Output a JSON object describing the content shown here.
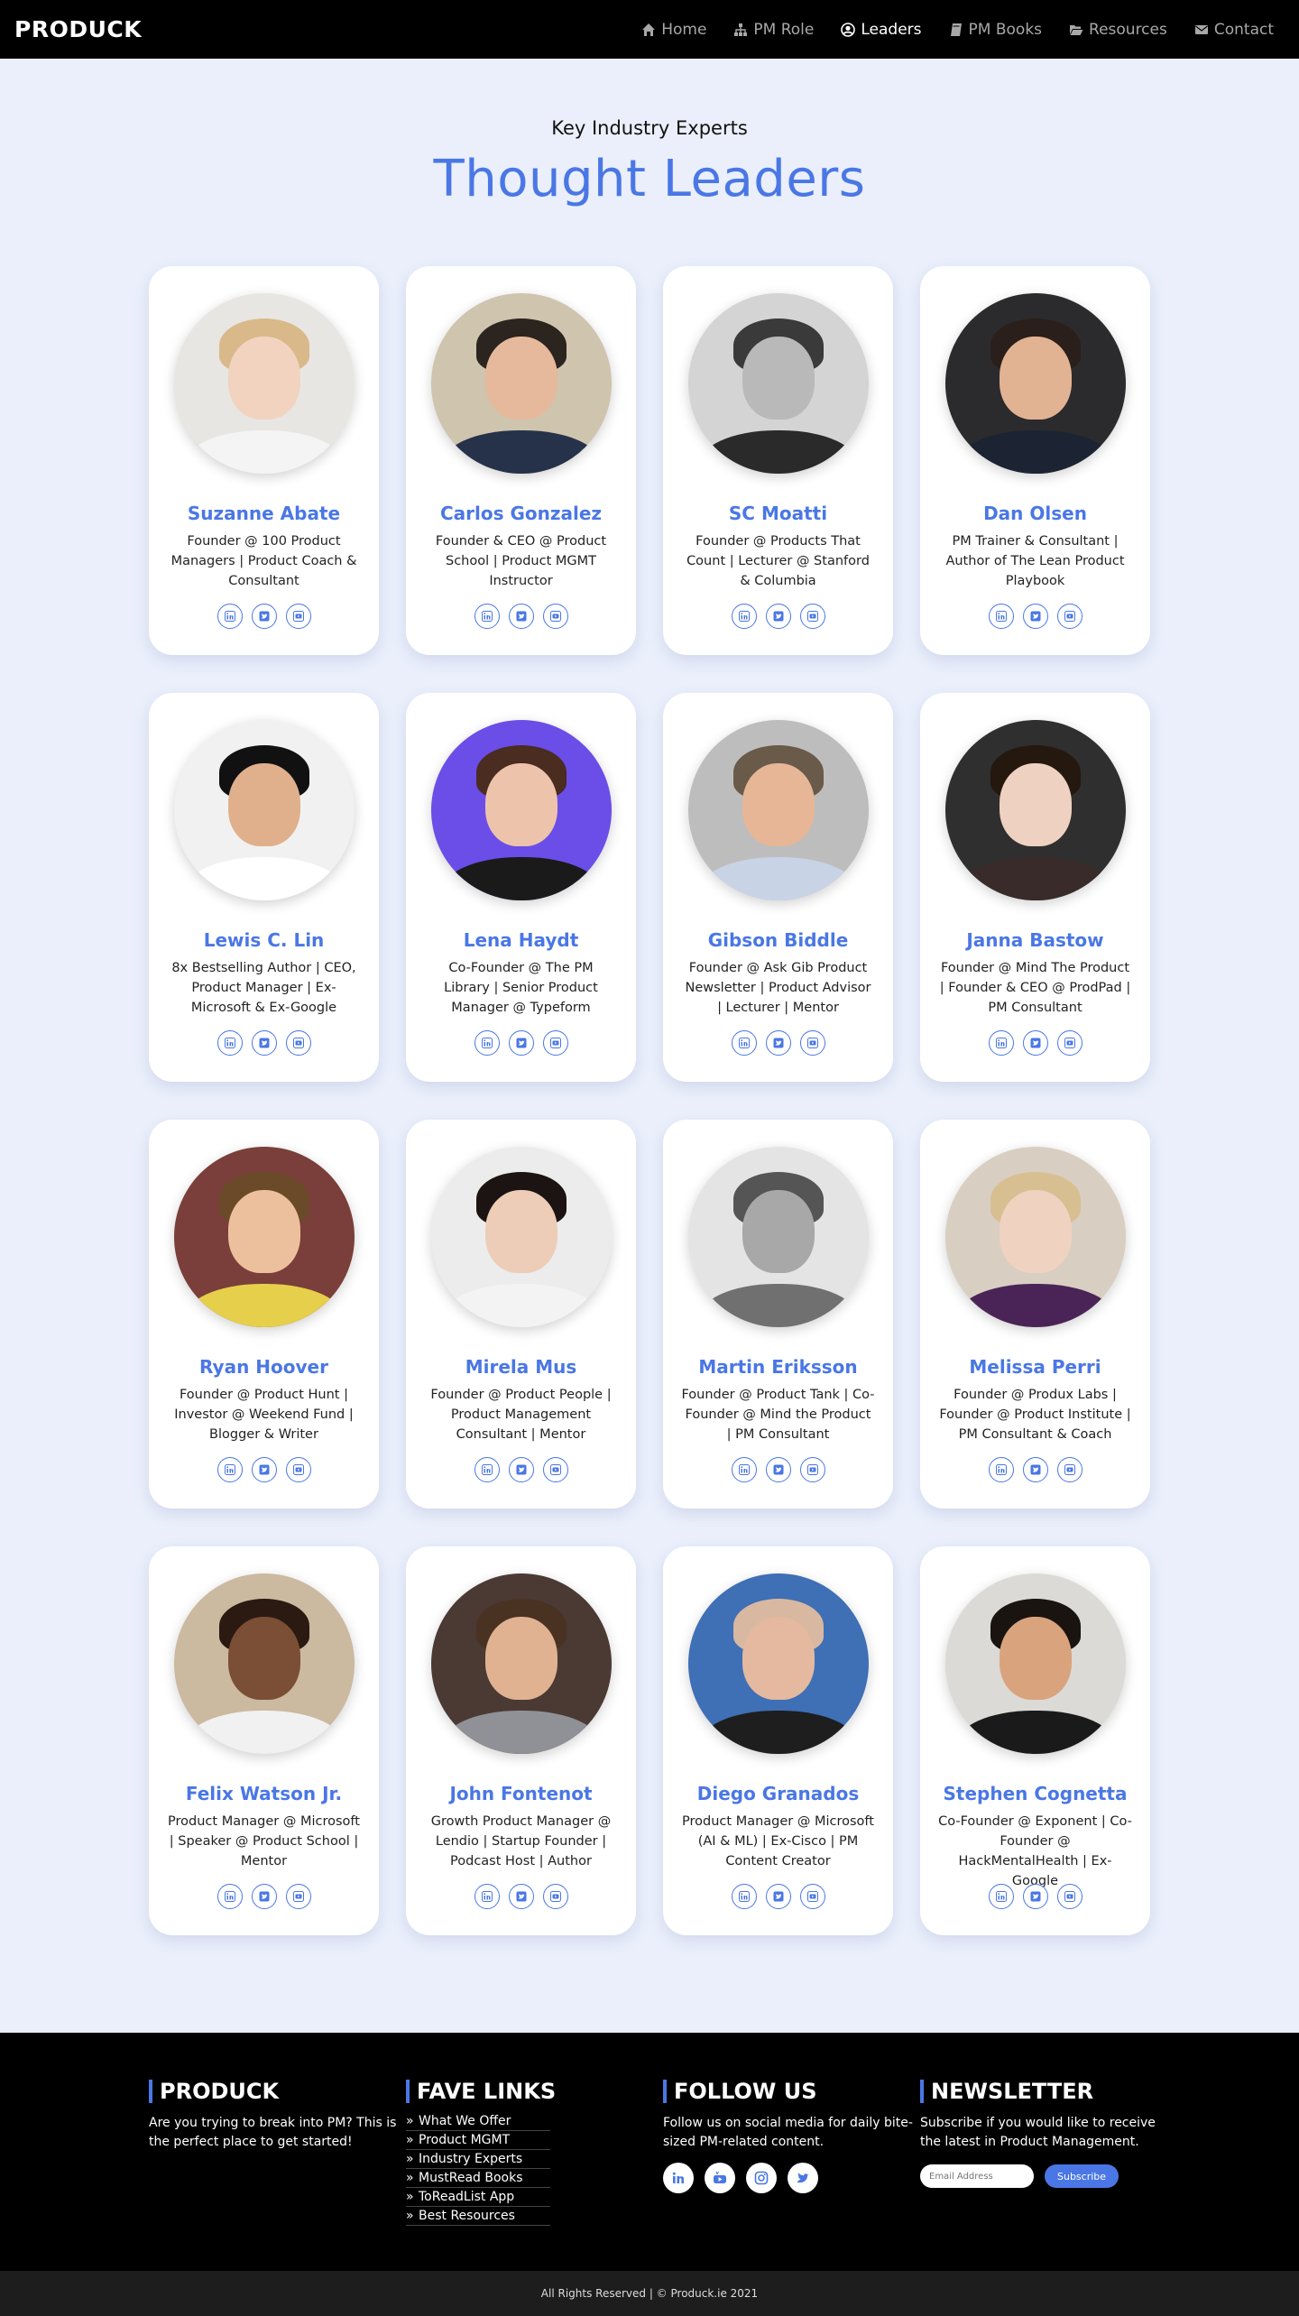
{
  "nav": {
    "brand": "PRODUCK",
    "items": [
      {
        "label": "Home",
        "icon": "home-icon"
      },
      {
        "label": "PM Role",
        "icon": "sitemap-icon"
      },
      {
        "label": "Leaders",
        "icon": "user-circle-icon",
        "active": true
      },
      {
        "label": "PM Books",
        "icon": "book-icon"
      },
      {
        "label": "Resources",
        "icon": "folder-open-icon"
      },
      {
        "label": "Contact",
        "icon": "envelope-icon"
      }
    ]
  },
  "hero": {
    "subtitle": "Key Industry Experts",
    "title": "Thought Leaders"
  },
  "colors": {
    "accent": "#4a77e5",
    "background": "#eaeffb",
    "nav": "#000000"
  },
  "leaders": [
    {
      "name": "Suzanne Abate",
      "role": "Founder @ 100 Product Managers | Product Coach & Consultant",
      "bg": "#e8e6e3",
      "skin": "#f1d3c0",
      "hair": "#d9b98a",
      "shirt": "#f4f4f4"
    },
    {
      "name": "Carlos Gonzalez",
      "role": "Founder & CEO @ Product School | Product MGMT Instructor",
      "bg": "#cfc4ae",
      "skin": "#e6b99c",
      "hair": "#2c241f",
      "shirt": "#26324a"
    },
    {
      "name": "SC Moatti",
      "role": "Founder @ Products That Count | Lecturer @ Stanford & Columbia",
      "bg": "#d4d4d4",
      "skin": "#b9b9b9",
      "hair": "#3a3a3a",
      "shirt": "#2a2a2a"
    },
    {
      "name": "Dan Olsen",
      "role": "PM Trainer & Consultant | Author of The Lean Product Playbook",
      "bg": "#2b2b2e",
      "skin": "#e2b393",
      "hair": "#2a1f1a",
      "shirt": "#1c2333"
    },
    {
      "name": "Lewis C. Lin",
      "role": "8x Bestselling Author | CEO, Product Manager | Ex-Microsoft & Ex-Google",
      "bg": "#f1f1f1",
      "skin": "#e0b08c",
      "hair": "#111111",
      "shirt": "#ffffff"
    },
    {
      "name": "Lena Haydt",
      "role": "Co-Founder @ The PM Library | Senior Product Manager @ Typeform",
      "bg": "#6b4de8",
      "skin": "#edc4ab",
      "hair": "#4a2c20",
      "shirt": "#1a1a1a"
    },
    {
      "name": "Gibson Biddle",
      "role": "Founder @ Ask Gib Product Newsletter | Product Advisor | Lecturer | Mentor",
      "bg": "#bdbdbd",
      "skin": "#e7b696",
      "hair": "#6a5a4a",
      "shirt": "#c9d3e6"
    },
    {
      "name": "Janna Bastow",
      "role": "Founder @ Mind The Product | Founder & CEO @ ProdPad | PM Consultant",
      "bg": "#2f2f2f",
      "skin": "#eed1c0",
      "hair": "#24180f",
      "shirt": "#3a2b2b"
    },
    {
      "name": "Ryan Hoover",
      "role": "Founder @ Product Hunt | Investor @ Weekend Fund | Blogger & Writer",
      "bg": "#7a3f3a",
      "skin": "#edc09d",
      "hair": "#6b4a2a",
      "shirt": "#e6cf4a"
    },
    {
      "name": "Mirela Mus",
      "role": "Founder @ Product People | Product Management Consultant | Mentor",
      "bg": "#ececec",
      "skin": "#edcdb8",
      "hair": "#1c1412",
      "shirt": "#f3f3f3"
    },
    {
      "name": "Martin Eriksson",
      "role": "Founder @ Product Tank | Co-Founder @ Mind the Product | PM Consultant",
      "bg": "#e4e4e4",
      "skin": "#a8a8a8",
      "hair": "#555555",
      "shirt": "#707070"
    },
    {
      "name": "Melissa Perri",
      "role": "Founder @ Produx Labs | Founder @ Product Institute | PM Consultant & Coach",
      "bg": "#d8cfc2",
      "skin": "#f0d2c1",
      "hair": "#d8bf92",
      "shirt": "#4b2457"
    },
    {
      "name": "Felix Watson Jr.",
      "role": "Product Manager @ Microsoft | Speaker @ Product School | Mentor",
      "bg": "#cbb9a0",
      "skin": "#7a4f35",
      "hair": "#2b1a12",
      "shirt": "#f1f1f1"
    },
    {
      "name": "John Fontenot",
      "role": "Growth Product Manager @ Lendio | Startup Founder | Podcast Host | Author",
      "bg": "#4a3a33",
      "skin": "#e0b292",
      "hair": "#4a3223",
      "shirt": "#8f9196"
    },
    {
      "name": "Diego Granados",
      "role": "Product Manager @ Microsoft (AI & ML) | Ex-Cisco | PM Content Creator",
      "bg": "#3f6fb5",
      "skin": "#e4b9a0",
      "hair": "#d8b8a0",
      "shirt": "#1e1e1e"
    },
    {
      "name": "Stephen Cognetta",
      "role": "Co-Founder @ Exponent | Co-Founder @ HackMentalHealth | Ex-Google",
      "bg": "#dcdad6",
      "skin": "#d9a37e",
      "hair": "#1a1410",
      "shirt": "#1a1a1a"
    }
  ],
  "card_socials": [
    "linkedin-icon",
    "twitter-icon",
    "youtube-icon"
  ],
  "footer": {
    "brand": {
      "title": "PRODUCK",
      "text": "Are you trying to break into PM? This is the perfect place to get started!"
    },
    "links": {
      "title": "FAVE LINKS",
      "items": [
        "What We Offer",
        "Product MGMT",
        "Industry Experts",
        "MustRead Books",
        "ToReadList App",
        "Best Resources"
      ]
    },
    "follow": {
      "title": "FOLLOW US",
      "text": "Follow us on social media for daily bite-sized PM-related content.",
      "icons": [
        "linkedin-icon",
        "youtube-icon",
        "instagram-icon",
        "twitter-icon"
      ]
    },
    "newsletter": {
      "title": "NEWSLETTER",
      "text": "Subscribe if you would like to receive the latest in Product Management.",
      "placeholder": "Email Address",
      "button": "Subscribe"
    },
    "copyright": "All Rights Reserved | © Produck.ie 2021"
  }
}
